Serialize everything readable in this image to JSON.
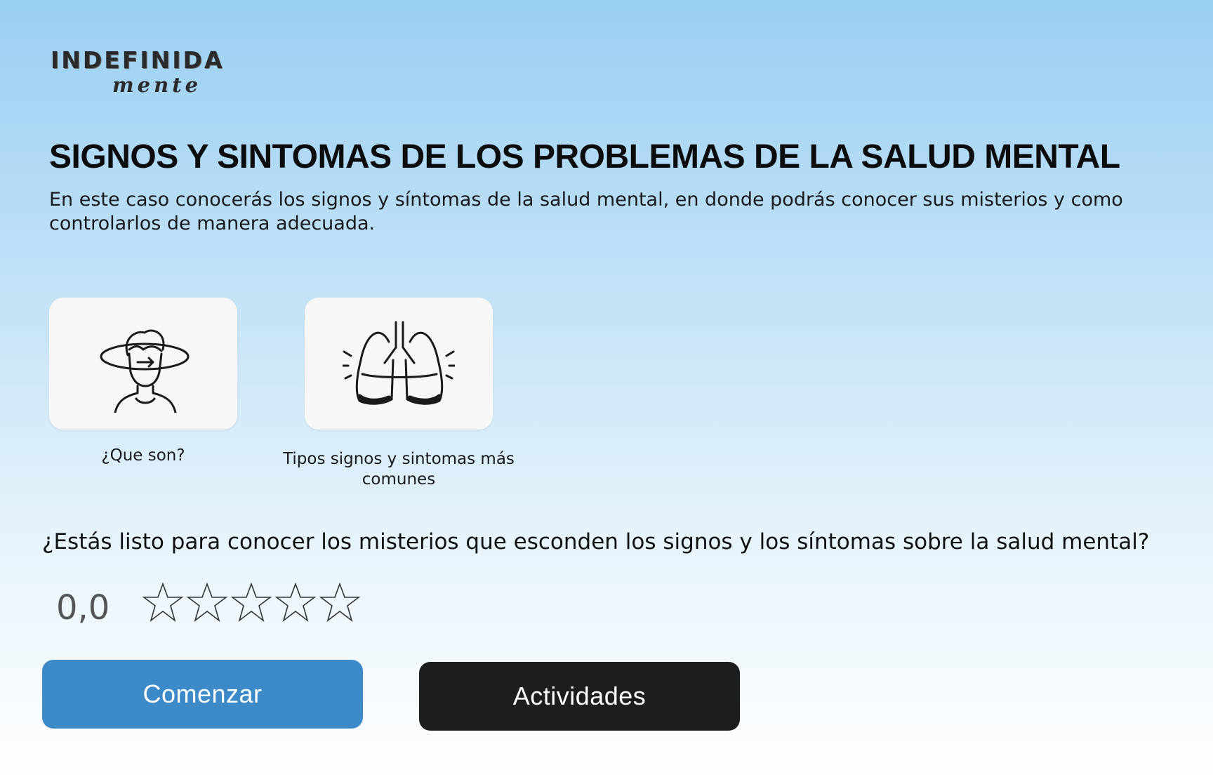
{
  "brand": {
    "logo_top": "INDEFINIDA",
    "logo_bottom": "mente"
  },
  "page": {
    "title": "SIGNOS Y SINTOMAS DE LOS PROBLEMAS DE LA SALUD MENTAL",
    "intro": "En este caso conocerás los signos y síntomas de la salud mental, en donde podrás conocer sus misterios y como controlarlos de manera adecuada."
  },
  "cards": [
    {
      "label": "¿Que son?",
      "icon": "person-head-rotation-icon"
    },
    {
      "label": "Tipos signos y sintomas más comunes",
      "icon": "lungs-icon"
    }
  ],
  "question": "¿Estás listo para conocer los misterios que esconden los signos y los síntomas sobre la salud mental?",
  "rating": {
    "value": "0,0",
    "stars_total": 5,
    "stars_filled": 0
  },
  "buttons": {
    "start_label": "Comenzar",
    "activities_label": "Actividades"
  },
  "colors": {
    "start_button": "#3d8ac9",
    "activities_button": "#1d1c1f",
    "background_top": "#99cff2",
    "background_bottom": "#ffffff"
  }
}
